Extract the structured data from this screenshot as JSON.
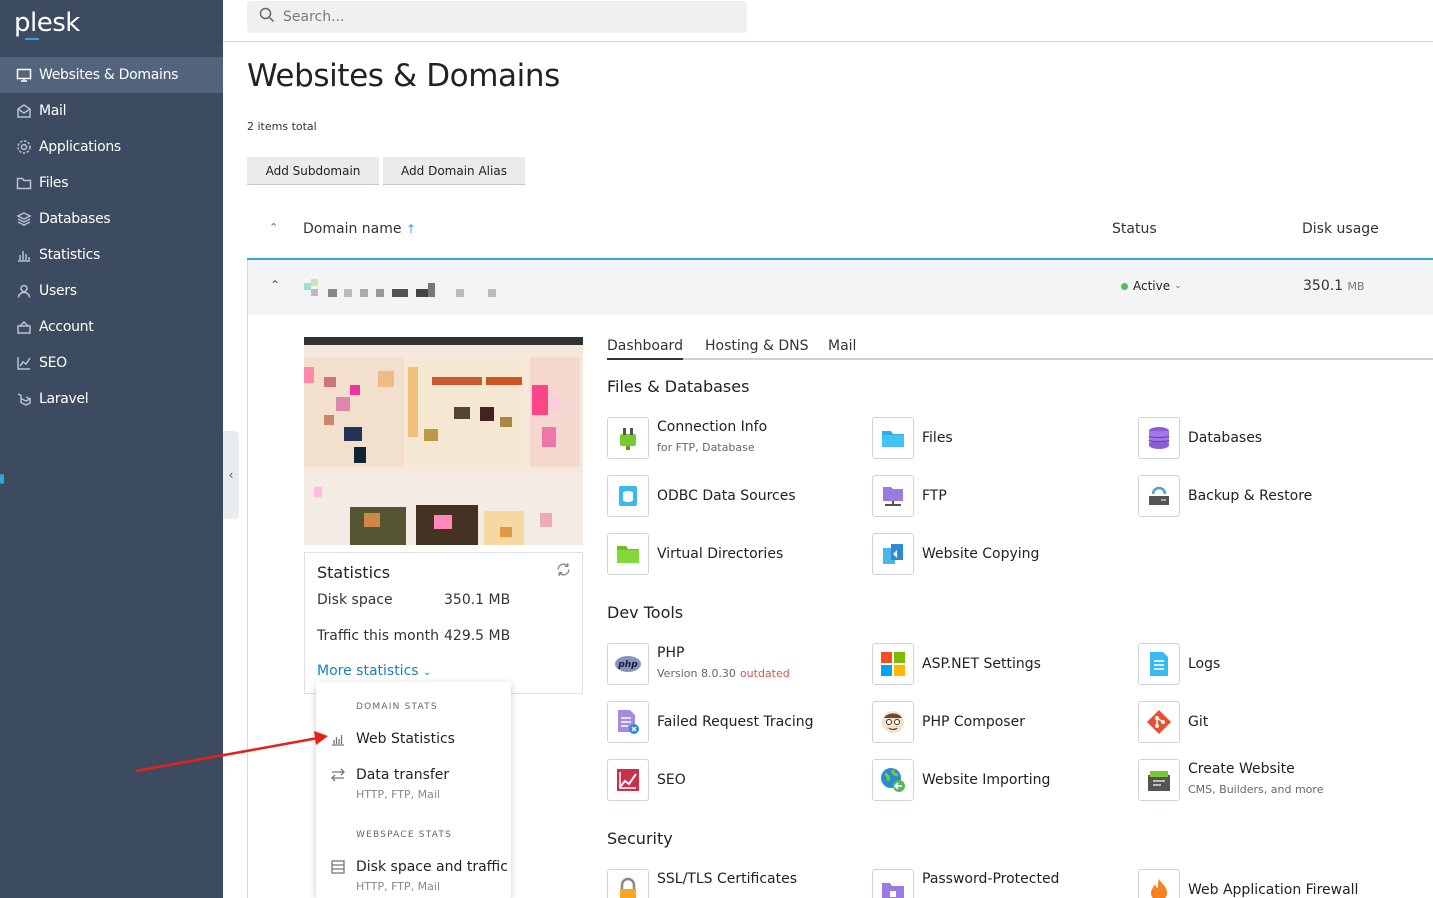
{
  "app": {
    "logo": "plesk"
  },
  "sidebar": {
    "items": [
      {
        "label": "Websites & Domains",
        "icon": "monitor-icon",
        "active": true
      },
      {
        "label": "Mail",
        "icon": "mail-icon"
      },
      {
        "label": "Applications",
        "icon": "gear-icon"
      },
      {
        "label": "Files",
        "icon": "folder-icon"
      },
      {
        "label": "Databases",
        "icon": "layers-icon"
      },
      {
        "label": "Statistics",
        "icon": "bar-chart-icon"
      },
      {
        "label": "Users",
        "icon": "user-icon"
      },
      {
        "label": "Account",
        "icon": "account-icon"
      },
      {
        "label": "SEO",
        "icon": "seo-icon"
      },
      {
        "label": "Laravel",
        "icon": "laravel-icon"
      }
    ]
  },
  "search": {
    "placeholder": "Search..."
  },
  "page": {
    "title": "Websites & Domains",
    "items_total": "2 items total",
    "buttons": {
      "add_subdomain": "Add Subdomain",
      "add_domain_alias": "Add Domain Alias"
    }
  },
  "table": {
    "headers": {
      "domain": "Domain name",
      "status": "Status",
      "disk": "Disk usage"
    },
    "row": {
      "status": "Active",
      "disk_value": "350.1",
      "disk_unit": "MB"
    }
  },
  "statistics": {
    "title": "Statistics",
    "disk_label": "Disk space",
    "disk_value": "350.1 MB",
    "traffic_label": "Traffic this month",
    "traffic_value": "429.5 MB",
    "more": "More statistics"
  },
  "dropdown": {
    "domain_stats": "DOMAIN STATS",
    "web_statistics": "Web Statistics",
    "data_transfer": "Data transfer",
    "data_transfer_sub": "HTTP, FTP, Mail",
    "webspace_stats": "WEBSPACE STATS",
    "disk_traffic": "Disk space and traffic",
    "disk_traffic_sub": "HTTP, FTP, Mail"
  },
  "tabs": [
    "Dashboard",
    "Hosting & DNS",
    "Mail"
  ],
  "sections": {
    "files_db": "Files & Databases",
    "dev_tools": "Dev Tools",
    "security": "Security"
  },
  "tools": {
    "connection_info": {
      "label": "Connection Info",
      "sub": "for FTP, Database"
    },
    "files": {
      "label": "Files"
    },
    "databases": {
      "label": "Databases"
    },
    "odbc": {
      "label": "ODBC Data Sources"
    },
    "ftp": {
      "label": "FTP"
    },
    "backup": {
      "label": "Backup & Restore"
    },
    "virtual_dirs": {
      "label": "Virtual Directories"
    },
    "website_copying": {
      "label": "Website Copying"
    },
    "php": {
      "label": "PHP",
      "sub": "Version 8.0.30",
      "badge": "outdated"
    },
    "aspnet": {
      "label": "ASP.NET Settings"
    },
    "logs": {
      "label": "Logs"
    },
    "failed_req": {
      "label": "Failed Request Tracing"
    },
    "composer": {
      "label": "PHP Composer"
    },
    "git": {
      "label": "Git"
    },
    "seo": {
      "label": "SEO"
    },
    "website_importing": {
      "label": "Website Importing"
    },
    "create_website": {
      "label": "Create Website",
      "sub": "CMS, Builders, and more"
    },
    "ssl": {
      "label": "SSL/TLS Certificates"
    },
    "password_dirs": {
      "label": "Password-Protected"
    },
    "waf": {
      "label": "Web Application Firewall"
    }
  }
}
